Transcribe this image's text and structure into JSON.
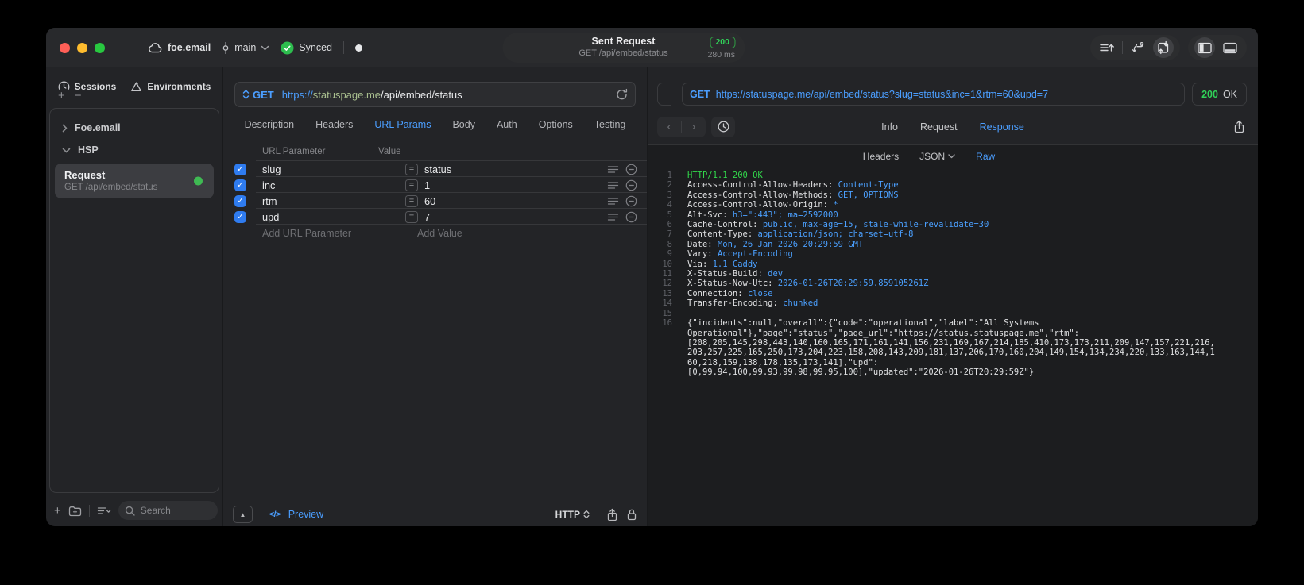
{
  "icons": {
    "check": "✓",
    "plus": "+",
    "minus": "−",
    "equals": "=",
    "code_tag": "</>",
    "triangle_up": "▲",
    "back": "‹",
    "forward": "›"
  },
  "titlebar": {
    "project": "foe.email",
    "branch": "main",
    "sync_label": "Synced",
    "center": {
      "title": "Sent Request",
      "subtitle": "GET /api/embed/status",
      "status_code": "200",
      "duration": "280 ms"
    }
  },
  "sidebar": {
    "tabs": [
      "Sessions",
      "Environments"
    ],
    "tree": [
      "Foe.email",
      "HSP"
    ],
    "request_item": {
      "title": "Request",
      "subtitle": "GET /api/embed/status"
    },
    "search_placeholder": "Search"
  },
  "request_pane": {
    "method": "GET",
    "url_scheme": "https://",
    "url_host": "statuspage.me",
    "url_path": "/api/embed/status",
    "tabs": [
      "Description",
      "Headers",
      "URL Params",
      "Body",
      "Auth",
      "Options",
      "Testing"
    ],
    "active_tab": "URL Params",
    "table": {
      "headers": [
        "URL Parameter",
        "Value"
      ],
      "rows": [
        {
          "name": "slug",
          "value": "status",
          "checked": true
        },
        {
          "name": "inc",
          "value": "1",
          "checked": true
        },
        {
          "name": "rtm",
          "value": "60",
          "checked": true
        },
        {
          "name": "upd",
          "value": "7",
          "checked": true
        }
      ],
      "add_name": "Add URL Parameter",
      "add_value": "Add Value"
    },
    "footer": {
      "preview": "Preview",
      "protocol": "HTTP"
    }
  },
  "response_pane": {
    "method": "GET",
    "url": "https://statuspage.me/api/embed/status?slug=status&inc=1&rtm=60&upd=7",
    "status_code": "200",
    "status_text": "OK",
    "tabs": [
      "Info",
      "Request",
      "Response"
    ],
    "active_tab": "Response",
    "subtabs": [
      "Headers",
      "JSON",
      "Raw"
    ],
    "active_subtab": "Raw",
    "code": {
      "status_line": {
        "num": "1",
        "text": "HTTP/1.1 200 OK"
      },
      "headers": [
        {
          "num": "2",
          "name": "Access-Control-Allow-Headers: ",
          "value": "Content-Type"
        },
        {
          "num": "3",
          "name": "Access-Control-Allow-Methods: ",
          "value": "GET, OPTIONS"
        },
        {
          "num": "4",
          "name": "Access-Control-Allow-Origin: ",
          "value": "*"
        },
        {
          "num": "5",
          "name": "Alt-Svc: ",
          "value": "h3=\":443\"; ma=2592000"
        },
        {
          "num": "6",
          "name": "Cache-Control: ",
          "value": "public, max-age=15, stale-while-revalidate=30"
        },
        {
          "num": "7",
          "name": "Content-Type: ",
          "value": "application/json; charset=utf-8"
        },
        {
          "num": "8",
          "name": "Date: ",
          "value": "Mon, 26 Jan 2026 20:29:59 GMT"
        },
        {
          "num": "9",
          "name": "Vary: ",
          "value": "Accept-Encoding"
        },
        {
          "num": "10",
          "name": "Via: ",
          "value": "1.1 Caddy"
        },
        {
          "num": "11",
          "name": "X-Status-Build: ",
          "value": "dev"
        },
        {
          "num": "12",
          "name": "X-Status-Now-Utc: ",
          "value": "2026-01-26T20:29:59.859105261Z"
        },
        {
          "num": "13",
          "name": "Connection: ",
          "value": "close"
        },
        {
          "num": "14",
          "name": "Transfer-Encoding: ",
          "value": "chunked"
        }
      ],
      "blank_line_num": "15",
      "body": {
        "num": "16",
        "lines": [
          "{\"incidents\":null,\"overall\":{\"code\":\"operational\",\"label\":\"All Systems",
          "Operational\"},\"page\":\"status\",\"page_url\":\"https://status.statuspage.me\",\"rtm\":",
          "[208,205,145,298,443,140,160,165,171,161,141,156,231,169,167,214,185,410,173,173,211,209,147,157,221,216,",
          "203,257,225,165,250,173,204,223,158,208,143,209,181,137,206,170,160,204,149,154,134,234,220,133,163,144,1",
          "60,218,159,138,178,135,173,141],\"upd\":",
          "[0,99.94,100,99.93,99.98,99.95,100],\"updated\":\"2026-01-26T20:29:59Z\"}"
        ]
      }
    }
  },
  "colors": {
    "accent_blue": "#4b9eff",
    "status_green": "#30d158",
    "checkbox_blue": "#2f7cf0",
    "badge_green": "#30d158"
  }
}
